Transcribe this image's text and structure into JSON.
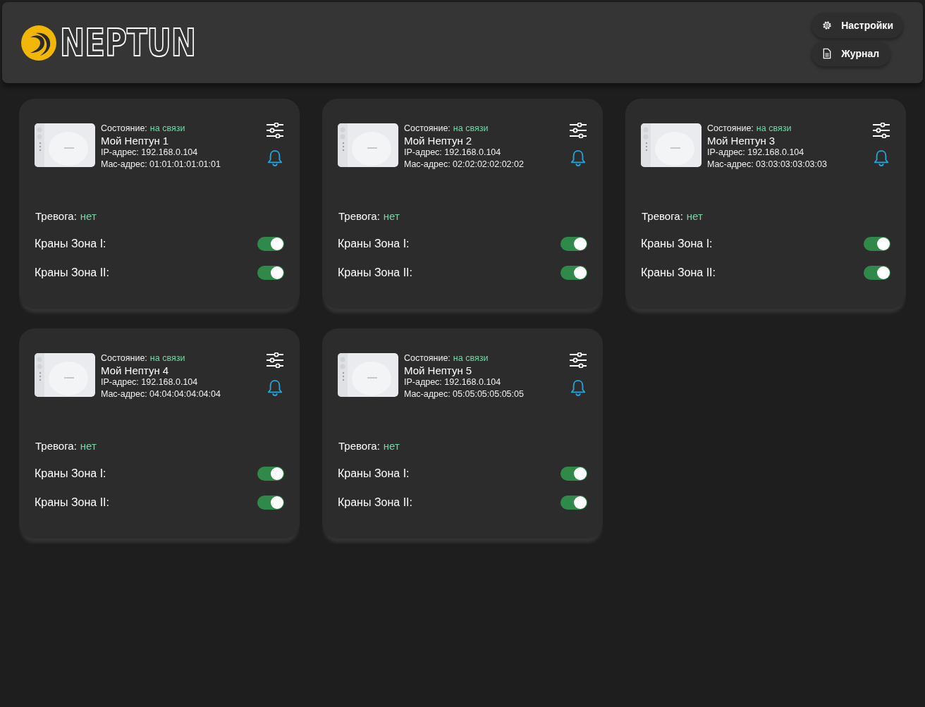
{
  "header": {
    "logo_text": "NEPTUN",
    "buttons": [
      {
        "kind": "settings",
        "label": "Настройки"
      },
      {
        "kind": "log",
        "label": "Журнал"
      }
    ]
  },
  "devices": [
    {
      "status_label": "Состояние:",
      "status": "на связи",
      "name": "Мой Нептун 1",
      "ip": "IP-адрес: 192.168.0.104",
      "mac": "Mac-адрес: 01:01:01:01:01:01",
      "alarm_label": "Тревога:",
      "alarm": "нет",
      "valves": [
        {
          "label": "Краны Зона I:",
          "on": true
        },
        {
          "label": "Краны Зона II:",
          "on": true
        }
      ]
    },
    {
      "status_label": "Состояние:",
      "status": "на связи",
      "name": "Мой Нептун 2",
      "ip": "IP-адрес: 192.168.0.104",
      "mac": "Mac-адрес: 02:02:02:02:02:02",
      "alarm_label": "Тревога:",
      "alarm": "нет",
      "valves": [
        {
          "label": "Краны Зона I:",
          "on": true
        },
        {
          "label": "Краны Зона II:",
          "on": true
        }
      ]
    },
    {
      "status_label": "Состояние:",
      "status": "на связи",
      "name": "Мой Нептун 3",
      "ip": "IP-адрес: 192.168.0.104",
      "mac": "Mac-адрес: 03:03:03:03:03:03",
      "alarm_label": "Тревога:",
      "alarm": "нет",
      "valves": [
        {
          "label": "Краны Зона I:",
          "on": true
        },
        {
          "label": "Краны Зона II:",
          "on": true
        }
      ]
    },
    {
      "status_label": "Состояние:",
      "status": "на связи",
      "name": "Мой Нептун 4",
      "ip": "IP-адрес: 192.168.0.104",
      "mac": "Mac-адрес: 04:04:04:04:04:04",
      "alarm_label": "Тревога:",
      "alarm": "нет",
      "valves": [
        {
          "label": "Краны Зона I:",
          "on": true
        },
        {
          "label": "Краны Зона II:",
          "on": true
        }
      ]
    },
    {
      "status_label": "Состояние:",
      "status": "на связи",
      "name": "Мой Нептун 5",
      "ip": "IP-адрес: 192.168.0.104",
      "mac": "Mac-адрес: 05:05:05:05:05:05",
      "alarm_label": "Тревога:",
      "alarm": "нет",
      "valves": [
        {
          "label": "Краны Зона I:",
          "on": true
        },
        {
          "label": "Краны Зона II:",
          "on": true
        }
      ]
    }
  ]
}
